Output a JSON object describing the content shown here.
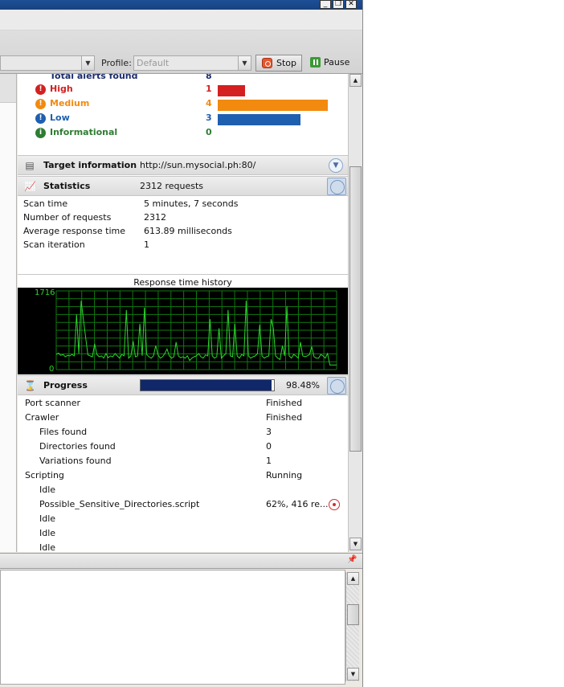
{
  "window": {
    "minimize_glyph": "_",
    "restore_glyph": "❐",
    "close_glyph": "✕"
  },
  "toolbar": {
    "profile_label": "Profile:",
    "profile_value": "Default",
    "stop_label": "Stop",
    "pause_label": "Pause"
  },
  "alerts": {
    "total_label": "Total alerts found",
    "total_value": "8",
    "max_count": 4,
    "levels": [
      {
        "label": "High",
        "count": "1",
        "color": "#d42020",
        "icon": "high-alert-icon",
        "glyph": "!"
      },
      {
        "label": "Medium",
        "count": "4",
        "color": "#f28a10",
        "icon": "medium-alert-icon",
        "glyph": "!"
      },
      {
        "label": "Low",
        "count": "3",
        "color": "#1f5fb0",
        "icon": "low-alert-icon",
        "glyph": "!"
      },
      {
        "label": "Informational",
        "count": "0",
        "color": "#2e7d32",
        "icon": "info-alert-icon",
        "glyph": "i"
      }
    ]
  },
  "target": {
    "title": "Target information",
    "url": "http://sun.mysocial.ph:80/"
  },
  "statistics": {
    "title": "Statistics",
    "summary": "2312 requests",
    "rows": [
      {
        "key": "Scan time",
        "value": "5 minutes, 7 seconds"
      },
      {
        "key": "Number of requests",
        "value": "2312"
      },
      {
        "key": "Average response time",
        "value": "613.89 milliseconds"
      },
      {
        "key": "Scan iteration",
        "value": "1"
      }
    ]
  },
  "chart_data": {
    "type": "line",
    "title": "Response time history",
    "ymax_label": "1716",
    "ymin_label": "0",
    "ylim": [
      0,
      1716
    ],
    "grid": true,
    "color": "#2ed52e",
    "values": [
      330,
      360,
      310,
      330,
      280,
      310,
      300,
      330,
      300,
      1200,
      350,
      1500,
      1100,
      700,
      320,
      300,
      280,
      560,
      330,
      280,
      300,
      250,
      350,
      260,
      300,
      280,
      350,
      300,
      250,
      330,
      300,
      1300,
      250,
      300,
      620,
      280,
      300,
      1000,
      300,
      1350,
      330,
      280,
      250,
      300,
      520,
      320,
      250,
      280,
      350,
      450,
      300,
      250,
      280,
      600,
      300,
      260,
      280,
      250,
      300,
      200,
      250,
      280,
      300,
      350,
      280,
      250,
      320,
      300,
      1100,
      300,
      250,
      280,
      900,
      250,
      300,
      350,
      1300,
      300,
      280,
      1000,
      300,
      250,
      330,
      300,
      1500,
      300,
      250,
      280,
      300,
      350,
      980,
      300,
      250,
      280,
      300,
      1100,
      900,
      300,
      250,
      220,
      520,
      300,
      1380,
      300,
      250,
      330,
      300,
      250,
      600,
      300,
      280,
      300,
      330,
      500,
      280,
      250,
      250,
      330,
      300,
      250,
      350,
      100,
      100,
      100,
      100
    ]
  },
  "progress": {
    "title": "Progress",
    "percent_label": "98.48%",
    "fraction": 0.9848,
    "rows": [
      {
        "key": "Port scanner",
        "value": "Finished",
        "indent": 0
      },
      {
        "key": "Crawler",
        "value": "Finished",
        "indent": 0
      },
      {
        "key": "Files found",
        "value": "3",
        "indent": 1
      },
      {
        "key": "Directories found",
        "value": "0",
        "indent": 1
      },
      {
        "key": "Variations found",
        "value": "1",
        "indent": 1
      },
      {
        "key": "Scripting",
        "value": "Running",
        "indent": 0
      },
      {
        "key": "Idle",
        "value": "",
        "indent": 1
      },
      {
        "key": "Possible_Sensitive_Directories.script",
        "value": "62%, 416 re...",
        "indent": 1,
        "stop": true
      },
      {
        "key": "Idle",
        "value": "",
        "indent": 1
      },
      {
        "key": "Idle",
        "value": "",
        "indent": 1
      },
      {
        "key": "Idle",
        "value": "",
        "indent": 1
      }
    ]
  },
  "scroll": {
    "up_glyph": "▲",
    "down_glyph": "▼"
  },
  "bottom_panel": {
    "pin_glyph": "📌"
  }
}
